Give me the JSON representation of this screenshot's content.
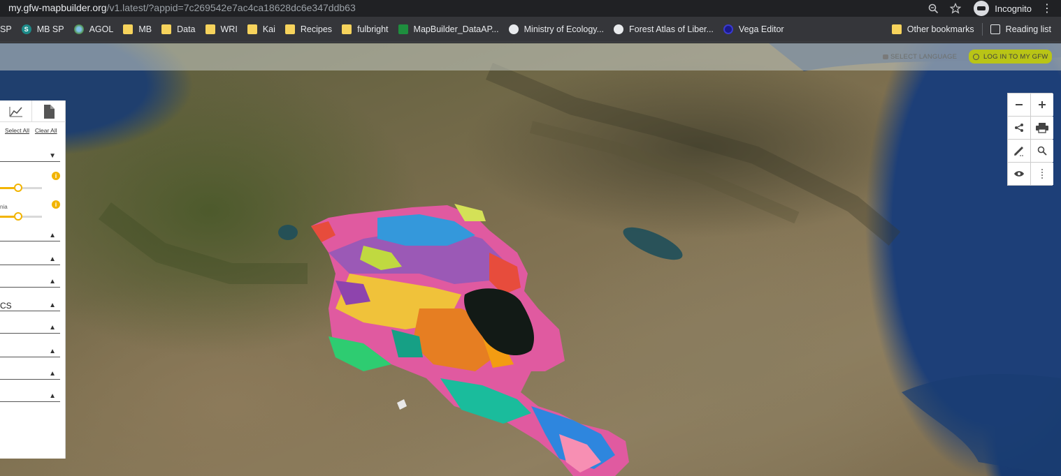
{
  "browser": {
    "url_host": "my.gfw-mapbuilder.org",
    "url_path": "/v1.latest/?appid=7c269542e7ac4ca18628dc6e347ddb63",
    "profile_label": "Incognito",
    "icons": [
      "zoom-icon",
      "star-icon",
      "incognito-icon",
      "kebab-menu-icon"
    ]
  },
  "bookmarks": {
    "items": [
      {
        "label": "SP",
        "icon": "folder"
      },
      {
        "label": "MB SP",
        "icon": "sharepoint"
      },
      {
        "label": "AGOL",
        "icon": "agol"
      },
      {
        "label": "MB",
        "icon": "folder"
      },
      {
        "label": "Data",
        "icon": "folder"
      },
      {
        "label": "WRI",
        "icon": "folder"
      },
      {
        "label": "Kai",
        "icon": "folder"
      },
      {
        "label": "Recipes",
        "icon": "folder"
      },
      {
        "label": "fulbright",
        "icon": "folder"
      },
      {
        "label": "MapBuilder_DataAP...",
        "icon": "sheets"
      },
      {
        "label": "Ministry of Ecology...",
        "icon": "globe"
      },
      {
        "label": "Forest Atlas of Liber...",
        "icon": "globe"
      },
      {
        "label": "Vega Editor",
        "icon": "vega"
      }
    ],
    "other_label": "Other bookmarks",
    "reading_label": "Reading list"
  },
  "header": {
    "language_label": "SELECT LANGUAGE",
    "login_label": "LOG IN TO MY GFW",
    "login_highlight_color": "#b9c416"
  },
  "panel": {
    "select_all": "Select All",
    "clear_all": "Clear All",
    "nia_label": "nia",
    "cs_label": "CS",
    "slider1_value": 0.42,
    "slider2_value": 0.42
  },
  "tools": [
    "zoom-out-icon",
    "zoom-in-icon",
    "share-icon",
    "print-icon",
    "draw-icon",
    "search-icon",
    "eye-icon",
    "more-icon"
  ]
}
